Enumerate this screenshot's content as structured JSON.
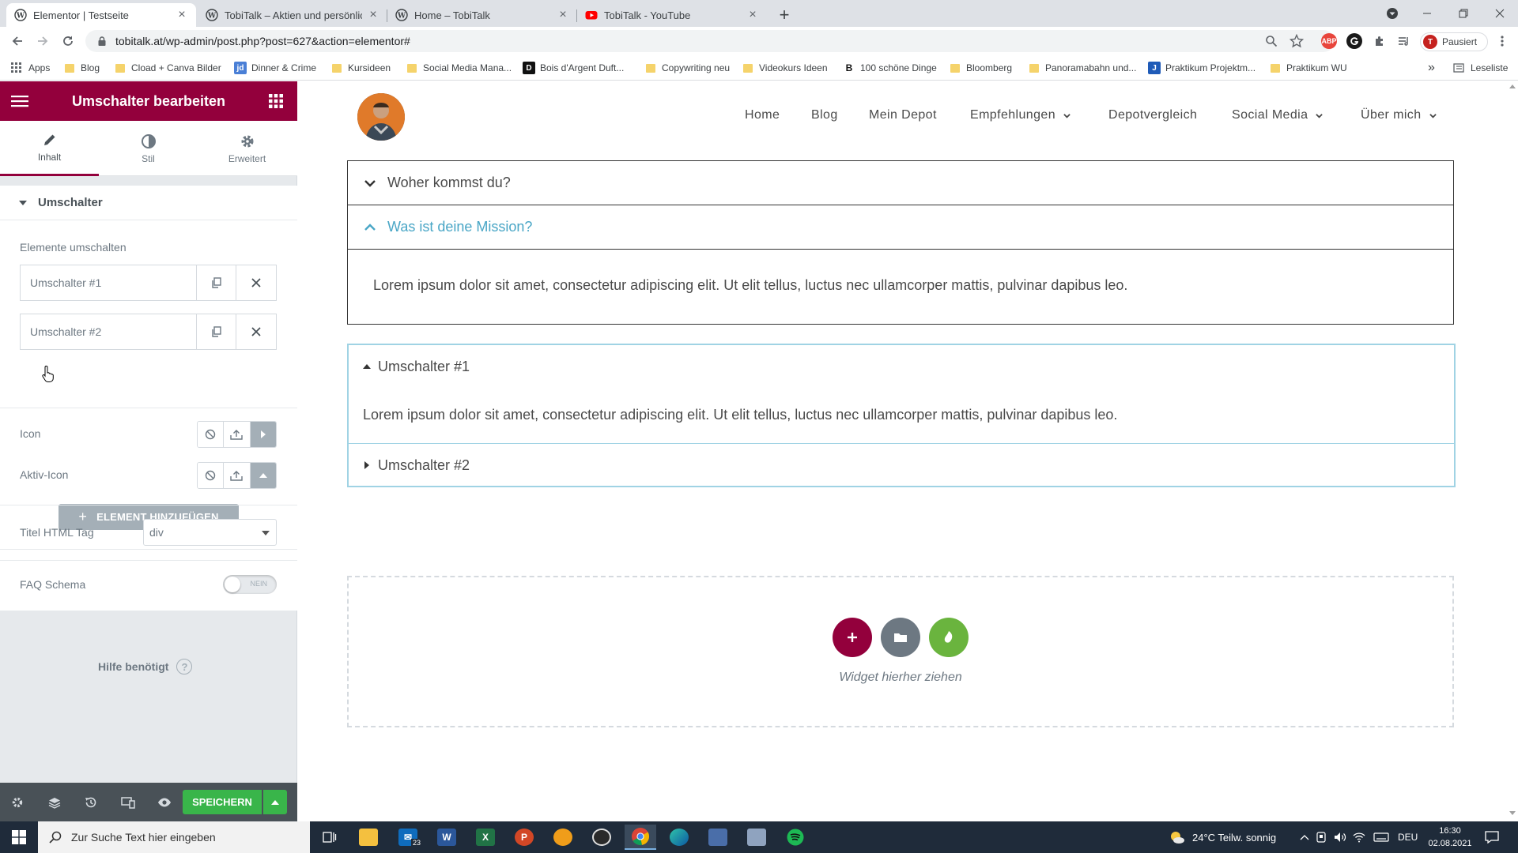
{
  "browser": {
    "tabs": [
      {
        "title": "Elementor | Testseite",
        "active": true
      },
      {
        "title": "TobiTalk – Aktien und persönliche",
        "active": false
      },
      {
        "title": "Home – TobiTalk",
        "active": false
      },
      {
        "title": "TobiTalk - YouTube",
        "active": false
      }
    ],
    "url": "tobitalk.at/wp-admin/post.php?post=627&action=elementor#",
    "profile_label": "Pausiert",
    "profile_initial": "T",
    "abp_label": "ABP",
    "bookmarks": [
      "Apps",
      "Blog",
      "Cload + Canva Bilder",
      "Dinner & Crime",
      "Kursideen",
      "Social Media Mana...",
      "Bois d'Argent Duft...",
      "Copywriting neu",
      "Videokurs Ideen",
      "100 schöne Dinge",
      "Bloomberg",
      "Panoramabahn und...",
      "Praktikum Projektm...",
      "Praktikum WU"
    ],
    "bookmarks_more": "»",
    "reading_list": "Leseliste"
  },
  "panel": {
    "title": "Umschalter bearbeiten",
    "tabs": [
      "Inhalt",
      "Stil",
      "Erweitert"
    ],
    "section_title": "Umschalter",
    "items_label": "Elemente umschalten",
    "items": [
      "Umschalter #1",
      "Umschalter #2"
    ],
    "add_button": "ELEMENT HINZUFÜGEN",
    "icon_label": "Icon",
    "active_icon_label": "Aktiv-Icon",
    "html_tag_label": "Titel HTML Tag",
    "html_tag_value": "div",
    "faq_label": "FAQ Schema",
    "faq_switch": "NEIN",
    "help": "Hilfe benötigt",
    "save": "SPEICHERN"
  },
  "preview": {
    "nav": [
      "Home",
      "Blog",
      "Mein Depot",
      "Empfehlungen",
      "Depotvergleich",
      "Social Media",
      "Über mich"
    ],
    "accordion": [
      {
        "title": "Woher kommst du?"
      },
      {
        "title": "Was ist deine Mission?",
        "content": "Lorem ipsum dolor sit amet, consectetur adipiscing elit. Ut elit tellus, luctus nec ullamcorper mattis, pulvinar dapibus leo."
      }
    ],
    "toggle": [
      {
        "title": "Umschalter #1",
        "content": "Lorem ipsum dolor sit amet, consectetur adipiscing elit. Ut elit tellus, luctus nec ullamcorper mattis, pulvinar dapibus leo."
      },
      {
        "title": "Umschalter #2"
      }
    ],
    "dropzone_text": "Widget hierher ziehen"
  },
  "taskbar": {
    "search_placeholder": "Zur Suche Text hier eingeben",
    "mail_badge": "23",
    "weather": "24°C  Teilw. sonnig",
    "lang": "DEU",
    "time": "16:30",
    "date": "02.08.2021"
  },
  "colors": {
    "elementor_brand": "#93003c",
    "accent_blue": "#49a6c6",
    "save_green": "#39b54a"
  }
}
